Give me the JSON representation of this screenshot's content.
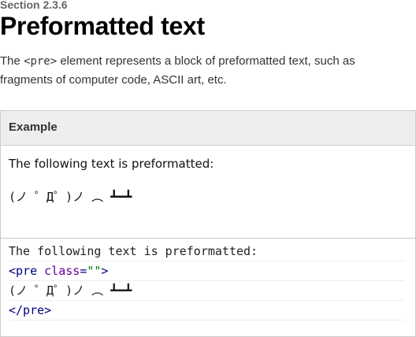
{
  "section": {
    "label": "Section 2.3.6"
  },
  "title": "Preformatted text",
  "intro": {
    "before": "The ",
    "code": "<pre>",
    "after": " element represents a block of preformatted text, such as fragments of computer code, ASCII art, etc."
  },
  "example": {
    "header": "Example",
    "rendered": {
      "line1": "The following text is preformatted:",
      "line2": "(ノ ゜Д゜)ノ ︵ ┻━┻"
    },
    "code": {
      "line1": "The following text is preformatted:",
      "line2": {
        "open": "<",
        "tag": "pre",
        "space": " ",
        "attr": "class",
        "eq": "=",
        "value": "\"\"",
        "close": ">"
      },
      "line3": "(ノ ゜Д゜)ノ ︵ ┻━┻",
      "line4": "</pre>"
    }
  }
}
